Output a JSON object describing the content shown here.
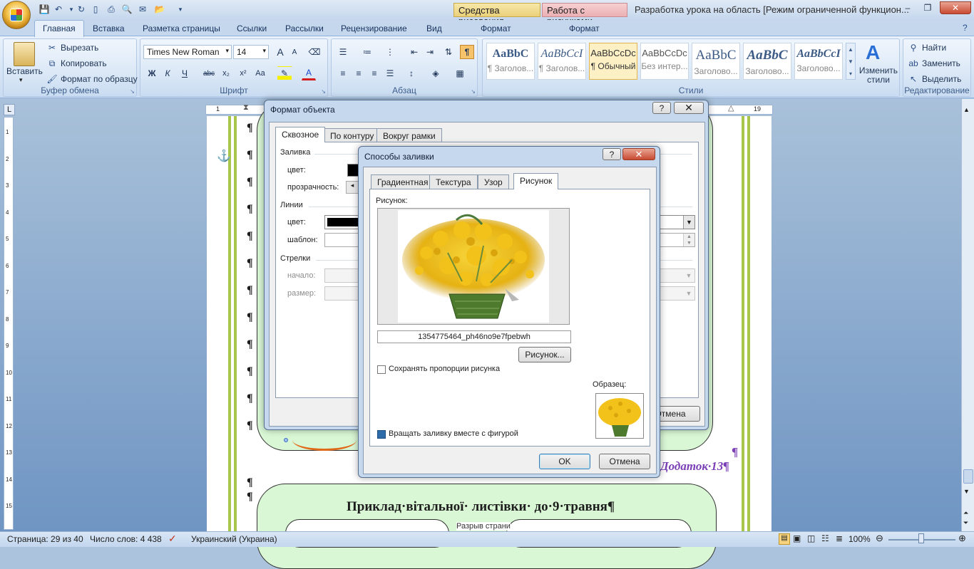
{
  "window": {
    "title": "Разработка урока на область [Режим ограниченной функцион...",
    "context_tab_drawing": "Средства рисования",
    "context_tab_picture": "Работа с рисунками",
    "minimize": "–",
    "maximize": "❐",
    "close": "✕"
  },
  "ribbon_tabs": [
    "Главная",
    "Вставка",
    "Разметка страницы",
    "Ссылки",
    "Рассылки",
    "Рецензирование",
    "Вид",
    "Формат",
    "Формат"
  ],
  "clipboard": {
    "paste": "Вставить",
    "cut": "Вырезать",
    "copy": "Копировать",
    "format_painter": "Формат по образцу",
    "group": "Буфер обмена"
  },
  "font": {
    "name": "Times New Roman",
    "size": "14",
    "group": "Шрифт",
    "bold": "Ж",
    "italic": "К",
    "underline": "Ч",
    "strike": "abc",
    "sub": "x₂",
    "sup": "x²",
    "case": "Aa",
    "grow": "A",
    "shrink": "A",
    "color": "A"
  },
  "paragraph": {
    "group": "Абзац",
    "pilcrow": "¶"
  },
  "styles": {
    "group": "Стили",
    "items": [
      {
        "preview": "AaBbC",
        "name": "¶ Заголов..."
      },
      {
        "preview": "AaBbCcI",
        "name": "¶ Заголов..."
      },
      {
        "preview": "AaBbCcDc",
        "name": "¶ Обычный"
      },
      {
        "preview": "AaBbCcDc",
        "name": "Без интер..."
      },
      {
        "preview": "AaBbC",
        "name": "Заголово..."
      },
      {
        "preview": "AaBbC",
        "name": "Заголово..."
      },
      {
        "preview": "AaBbCcI",
        "name": "Заголово..."
      }
    ],
    "change_styles": "Изменить стили"
  },
  "editing": {
    "group": "Редактирование",
    "find": "Найти",
    "replace": "Заменить",
    "select": "Выделить"
  },
  "ruler": {
    "left": "1",
    "right": "19",
    "vertical": [
      "1",
      "2",
      "3",
      "4",
      "5",
      "6",
      "7",
      "8",
      "9",
      "10",
      "11",
      "12",
      "13",
      "14",
      "15"
    ]
  },
  "document": {
    "caption": "Додаток·13¶",
    "heading": "Приклад·вітальної· листівки· до·9·травня¶",
    "page_break": "Разрыв страни",
    "pilcrow": "¶"
  },
  "format_dialog": {
    "title": "Формат объекта",
    "tabs": [
      "Сквозное",
      "По контуру",
      "Вокруг рамки"
    ],
    "fill_section": "Заливка",
    "fill_color_label": "цвет:",
    "transparency_label": "прозрачность:",
    "lines_section": "Линии",
    "line_color_label": "цвет:",
    "pattern_label": "шаблон:",
    "arrows_section": "Стрелки",
    "start_label": "начало:",
    "size_label": "размер:",
    "cancel": "Отмена"
  },
  "fill_dialog": {
    "title": "Способы заливки",
    "tabs": [
      "Градиентная",
      "Текстура",
      "Узор",
      "Рисунок"
    ],
    "picture_label": "Рисунок:",
    "file_name": "1354775464_ph46no9e7fpebwh",
    "picture_button": "Рисунок...",
    "keep_ratio": "Сохранять пропорции рисунка",
    "rotate_with_shape": "Вращать заливку вместе с фигурой",
    "sample_label": "Образец:",
    "ok": "OK",
    "cancel": "Отмена"
  },
  "status": {
    "page": "Страница: 29 из 40",
    "words": "Число слов: 4 438",
    "language": "Украинский (Украина)",
    "zoom": "100%"
  },
  "colors": {
    "accent_green": "#a7c64a",
    "mimosa_yellow": "#f2c21a",
    "heading_purple": "#7b3fb6"
  }
}
